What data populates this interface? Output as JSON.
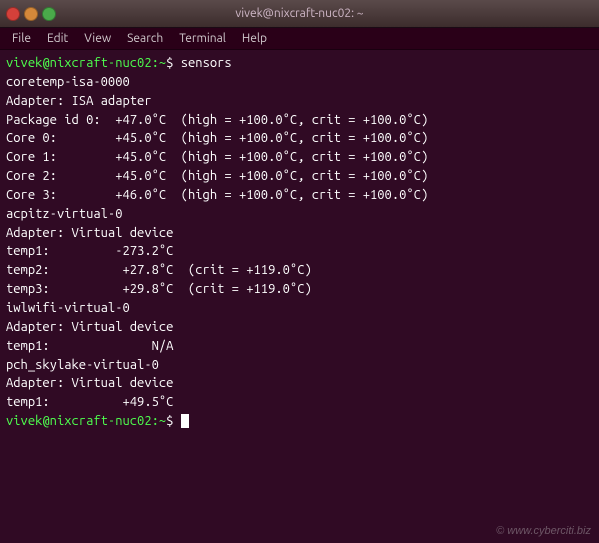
{
  "titlebar": {
    "title": "vivek@nixcraft-nuc02: ~",
    "close_label": "×",
    "min_label": "−",
    "max_label": "+"
  },
  "menubar": {
    "items": [
      "File",
      "Edit",
      "View",
      "Search",
      "Terminal",
      "Help"
    ]
  },
  "terminal": {
    "lines": [
      {
        "type": "prompt",
        "text": "vivek@nixcraft-nuc02:~$ sensors"
      },
      {
        "type": "output",
        "text": "coretemp-isa-0000"
      },
      {
        "type": "output",
        "text": "Adapter: ISA adapter"
      },
      {
        "type": "output",
        "text": "Package id 0:  +47.0°C  (high = +100.0°C, crit = +100.0°C)"
      },
      {
        "type": "output",
        "text": "Core 0:        +45.0°C  (high = +100.0°C, crit = +100.0°C)"
      },
      {
        "type": "output",
        "text": "Core 1:        +45.0°C  (high = +100.0°C, crit = +100.0°C)"
      },
      {
        "type": "output",
        "text": "Core 2:        +45.0°C  (high = +100.0°C, crit = +100.0°C)"
      },
      {
        "type": "output",
        "text": "Core 3:        +46.0°C  (high = +100.0°C, crit = +100.0°C)"
      },
      {
        "type": "blank",
        "text": ""
      },
      {
        "type": "output",
        "text": "acpitz-virtual-0"
      },
      {
        "type": "output",
        "text": "Adapter: Virtual device"
      },
      {
        "type": "output",
        "text": "temp1:         -273.2°C"
      },
      {
        "type": "output",
        "text": "temp2:          +27.8°C  (crit = +119.0°C)"
      },
      {
        "type": "output",
        "text": "temp3:          +29.8°C  (crit = +119.0°C)"
      },
      {
        "type": "blank",
        "text": ""
      },
      {
        "type": "output",
        "text": "iwlwifi-virtual-0"
      },
      {
        "type": "output",
        "text": "Adapter: Virtual device"
      },
      {
        "type": "output",
        "text": "temp1:              N/A"
      },
      {
        "type": "blank",
        "text": ""
      },
      {
        "type": "output",
        "text": "pch_skylake-virtual-0"
      },
      {
        "type": "output",
        "text": "Adapter: Virtual device"
      },
      {
        "type": "output",
        "text": "temp1:          +49.5°C"
      },
      {
        "type": "blank",
        "text": ""
      },
      {
        "type": "prompt_end",
        "text": "vivek@nixcraft-nuc02:~$ "
      }
    ],
    "watermark": "© www.cyberciti.biz"
  }
}
